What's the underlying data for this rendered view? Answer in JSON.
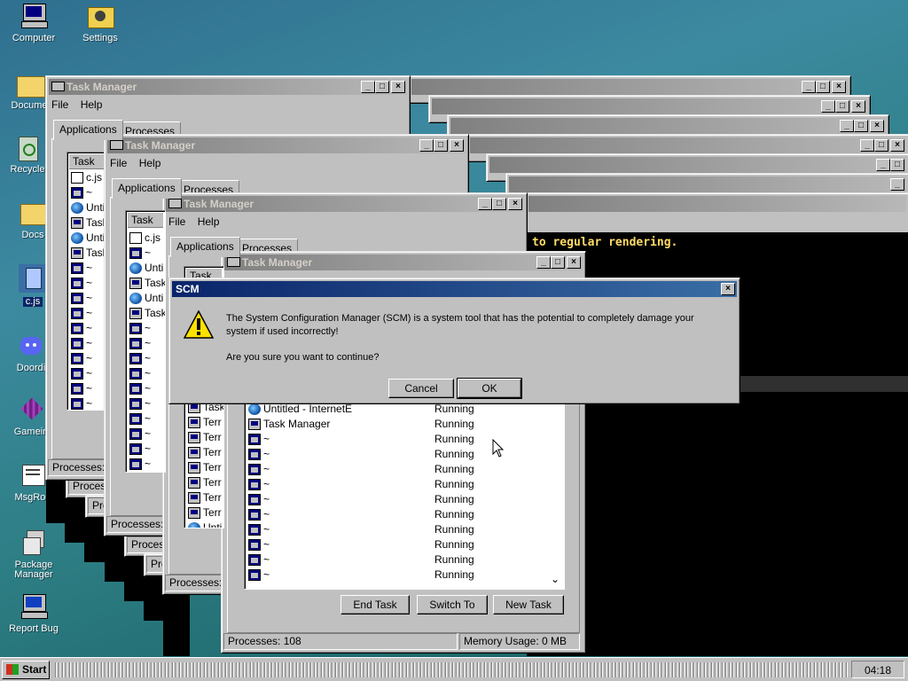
{
  "desktop": {
    "icons": [
      {
        "label": "Computer",
        "icon": "computer-icon"
      },
      {
        "label": "Settings",
        "icon": "settings-icon"
      },
      {
        "label": "Docume",
        "icon": "folder-icon"
      },
      {
        "label": "Recycle",
        "icon": "recycle-bin-icon"
      },
      {
        "label": "Docs",
        "icon": "folder-icon"
      },
      {
        "label": "c.js",
        "icon": "script-file-icon"
      },
      {
        "label": "Doordi",
        "icon": "discord-icon"
      },
      {
        "label": "Gamein",
        "icon": "game-icon"
      },
      {
        "label": "MsgRoo",
        "icon": "message-icon"
      },
      {
        "label": "Package Manager",
        "icon": "package-icon"
      },
      {
        "label": "Report Bug",
        "icon": "report-bug-icon"
      }
    ]
  },
  "task_manager": {
    "title": "Task Manager",
    "menu": [
      "File",
      "Help"
    ],
    "tabs": [
      "Applications",
      "Processes"
    ],
    "column_task": "Task",
    "rows_w1": [
      "c.js",
      "~",
      "Unti",
      "Task",
      "Unti",
      "Task",
      "~",
      "~",
      "~",
      "~",
      "~",
      "~",
      "~",
      "~",
      "~",
      "~"
    ],
    "rows_w3": [
      "c.js",
      "~",
      "Unti",
      "Task",
      "Unti",
      "Task",
      "~",
      "~",
      "~",
      "~",
      "~",
      "~",
      "~",
      "~",
      "~",
      "~"
    ],
    "rows_w4": [
      "Task",
      "Terr",
      "Terr",
      "Terr",
      "Terr",
      "Terr",
      "Terr",
      "Terr",
      "Unti",
      "Task"
    ],
    "status_w1": "Processes: 2",
    "status_w2": "Processes: 10",
    "status_w3": "Processes: 10",
    "back_status": [
      "Process",
      "Pro",
      "Pro",
      "Process",
      "Pro"
    ],
    "main": {
      "rows": [
        {
          "name": "Untitled - InternetE",
          "status": "Running",
          "icon": "globe-icon"
        },
        {
          "name": "Task Manager",
          "status": "Running",
          "icon": "computer-icon"
        },
        {
          "name": "~",
          "status": "Running",
          "icon": "app-icon"
        },
        {
          "name": "~",
          "status": "Running",
          "icon": "app-icon"
        },
        {
          "name": "~",
          "status": "Running",
          "icon": "app-icon"
        },
        {
          "name": "~",
          "status": "Running",
          "icon": "app-icon"
        },
        {
          "name": "~",
          "status": "Running",
          "icon": "app-icon"
        },
        {
          "name": "~",
          "status": "Running",
          "icon": "app-icon"
        },
        {
          "name": "~",
          "status": "Running",
          "icon": "app-icon"
        },
        {
          "name": "~",
          "status": "Running",
          "icon": "app-icon"
        },
        {
          "name": "~",
          "status": "Running",
          "icon": "app-icon"
        },
        {
          "name": "~",
          "status": "Running",
          "icon": "app-icon"
        }
      ],
      "buttons": [
        "End Task",
        "Switch To",
        "New Task"
      ],
      "status_processes": "Processes: 108",
      "status_memory": "Memory Usage: 0 MB"
    }
  },
  "console": {
    "text": "to regular rendering."
  },
  "dialog": {
    "title": "SCM",
    "message": "The System Configuration Manager (SCM) is a system tool that has the potential to completely damage your system if used incorrectly!",
    "question": "Are you sure you want to continue?",
    "cancel_label": "Cancel",
    "ok_label": "OK",
    "icon": "warning-icon"
  },
  "taskbar": {
    "start_label": "Start",
    "clock": "04:18"
  },
  "colors": {
    "active_title": "#0a246a",
    "inactive_title": "#808080",
    "console_text": "#ffdc64"
  }
}
